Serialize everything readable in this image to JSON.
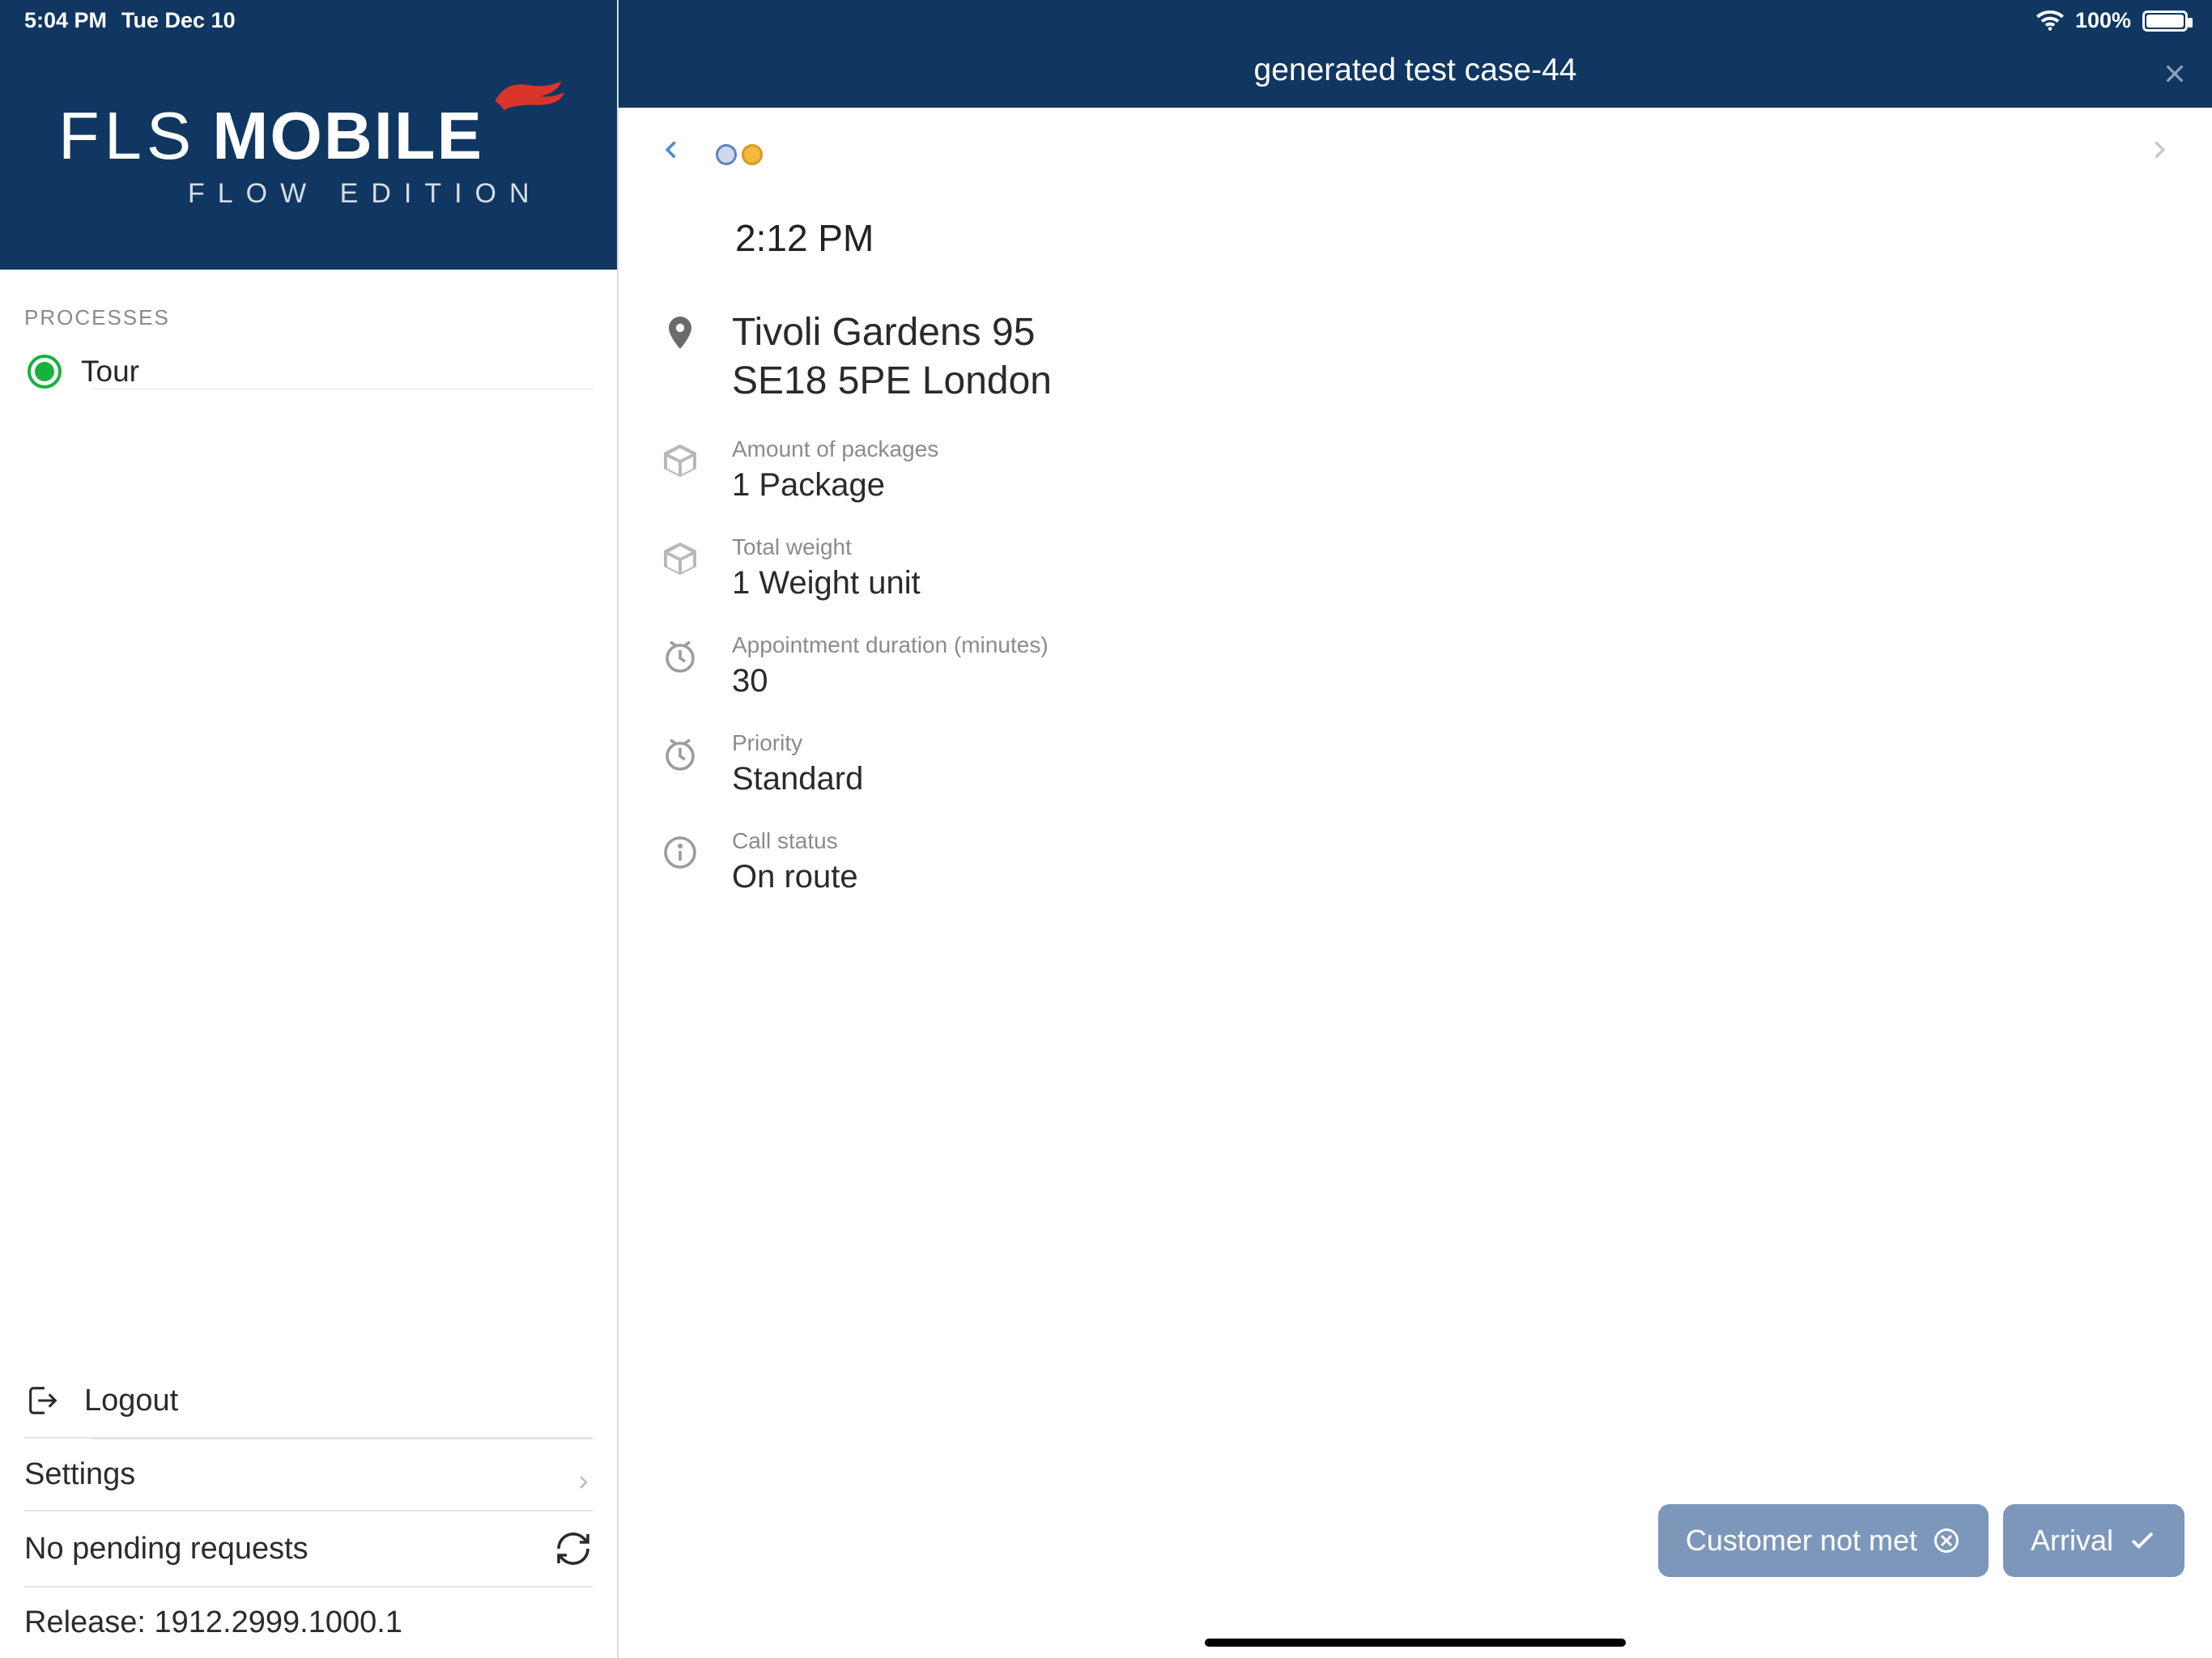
{
  "status_bar": {
    "time": "5:04 PM",
    "date": "Tue Dec 10",
    "battery_pct": "100%"
  },
  "brand": {
    "fls": "FLS",
    "mobile": "MOBILE",
    "subtitle": "FLOW EDITION"
  },
  "sidebar": {
    "processes_label": "PROCESSES",
    "items": [
      {
        "name": "Tour"
      }
    ],
    "logout_label": "Logout",
    "settings_label": "Settings",
    "pending_label": "No pending requests",
    "release_label": "Release: 1912.2999.1000.1"
  },
  "header": {
    "title": "generated test case-44"
  },
  "detail": {
    "time": "2:12 PM",
    "address_line1": "Tivoli Gardens 95",
    "address_line2": "SE18 5PE London",
    "fields": {
      "packages": {
        "label": "Amount of packages",
        "value": "1 Package"
      },
      "weight": {
        "label": "Total weight",
        "value": "1 Weight unit"
      },
      "duration": {
        "label": "Appointment duration (minutes)",
        "value": "30"
      },
      "priority": {
        "label": "Priority",
        "value": "Standard"
      },
      "status": {
        "label": "Call status",
        "value": "On route"
      }
    }
  },
  "actions": {
    "not_met": "Customer not met",
    "arrival": "Arrival"
  }
}
